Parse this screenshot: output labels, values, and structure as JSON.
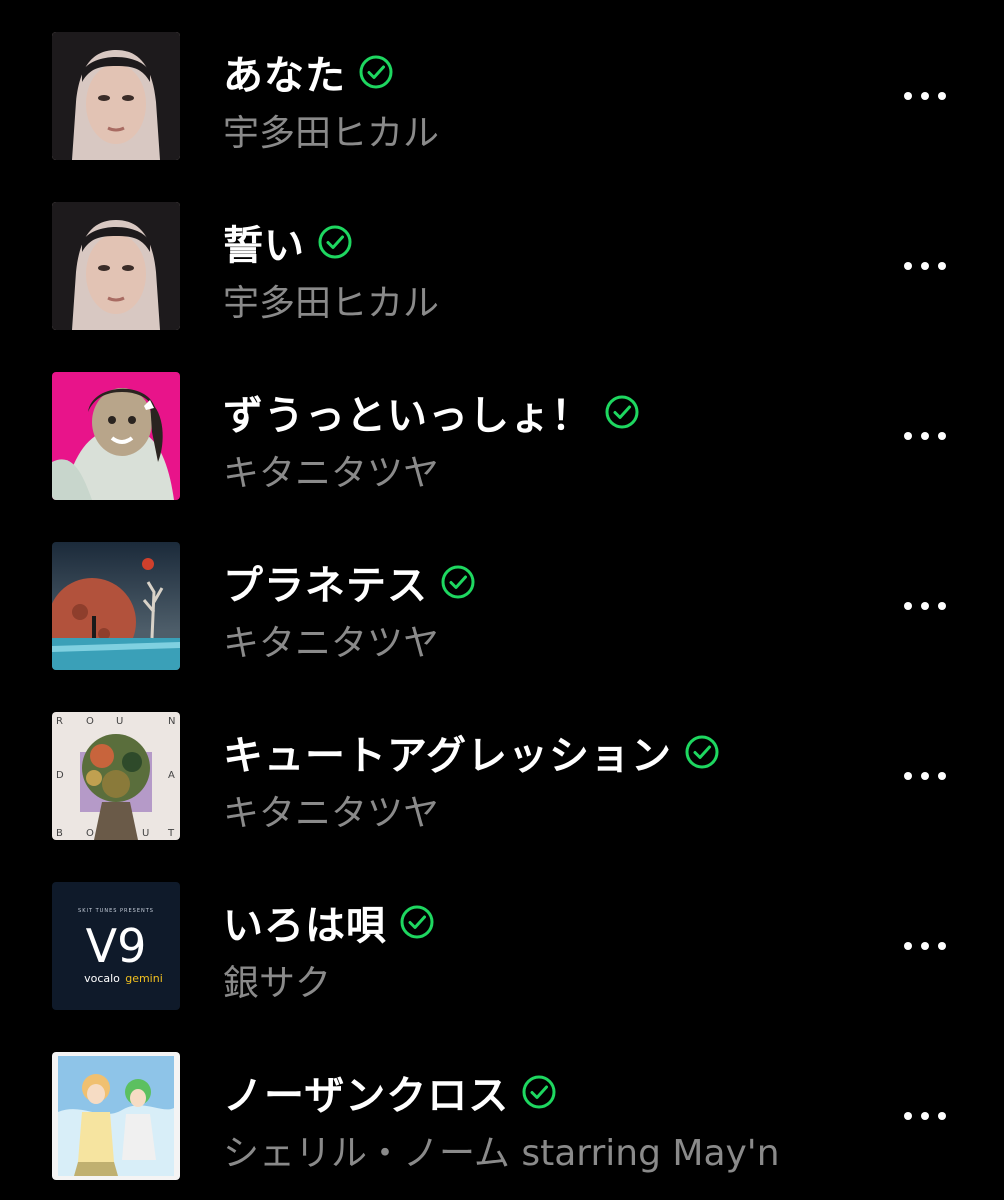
{
  "theme": {
    "background": "#000000",
    "title_color": "#ffffff",
    "artist_color": "#8a8a8a",
    "downloaded_check_color": "#1ed760"
  },
  "tracks": [
    {
      "title": "あなた",
      "artist": "宇多田ヒカル",
      "downloaded": true,
      "artwork": "portrait-woman-dark-hair",
      "more_icon": "ellipsis-icon"
    },
    {
      "title": "誓い",
      "artist": "宇多田ヒカル",
      "downloaded": true,
      "artwork": "portrait-woman-dark-hair",
      "more_icon": "ellipsis-icon"
    },
    {
      "title": "ずうっといっしょ！",
      "artist": "キタニタツヤ",
      "downloaded": true,
      "artwork": "anime-girl-pink-background",
      "more_icon": "ellipsis-icon"
    },
    {
      "title": "プラネテス",
      "artist": "キタニタツヤ",
      "downloaded": true,
      "artwork": "red-moon-ocean-landscape",
      "more_icon": "ellipsis-icon"
    },
    {
      "title": "キュートアグレッション",
      "artist": "キタニタツヤ",
      "downloaded": true,
      "artwork": "botanical-collage-roundabout",
      "more_icon": "ellipsis-icon"
    },
    {
      "title": "いろは唄",
      "artist": "銀サク",
      "downloaded": true,
      "artwork": "v9-vocalo-gemini-logo",
      "more_icon": "ellipsis-icon"
    },
    {
      "title": "ノーザンクロス",
      "artist": "シェリル・ノーム starring May'n",
      "downloaded": true,
      "artwork": "anime-duo-sky",
      "more_icon": "ellipsis-icon"
    }
  ],
  "artwork_text": {
    "round_about": [
      "R",
      "O",
      "U",
      "N",
      "D",
      "A",
      "B",
      "O",
      "U",
      "T"
    ],
    "v9_caption": "SKIT TUNES PRESENTS",
    "v9_logo": "V9",
    "v9_sub_left": "vocalo",
    "v9_sub_right": "gemini"
  }
}
